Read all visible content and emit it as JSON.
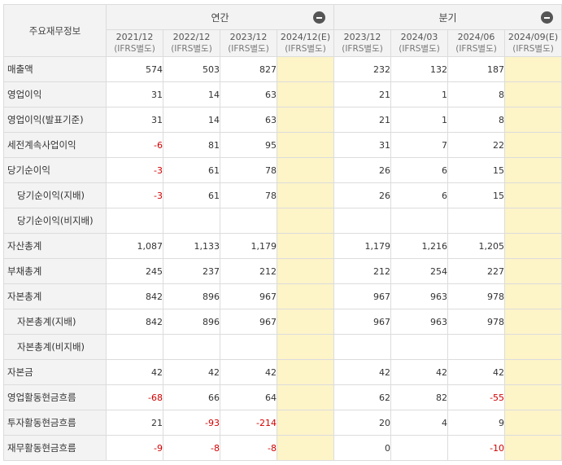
{
  "header": {
    "corner_label": "주요재무정보",
    "groups": [
      {
        "label": "연간",
        "span": 4
      },
      {
        "label": "분기",
        "span": 4
      }
    ],
    "periods": [
      {
        "date": "2021/12",
        "basis": "(IFRS별도)",
        "estimate": false
      },
      {
        "date": "2022/12",
        "basis": "(IFRS별도)",
        "estimate": false
      },
      {
        "date": "2023/12",
        "basis": "(IFRS별도)",
        "estimate": false
      },
      {
        "date": "2024/12(E)",
        "basis": "(IFRS별도)",
        "estimate": true
      },
      {
        "date": "2023/12",
        "basis": "(IFRS별도)",
        "estimate": false
      },
      {
        "date": "2024/03",
        "basis": "(IFRS별도)",
        "estimate": false
      },
      {
        "date": "2024/06",
        "basis": "(IFRS별도)",
        "estimate": false
      },
      {
        "date": "2024/09(E)",
        "basis": "(IFRS별도)",
        "estimate": true
      }
    ]
  },
  "colors": {
    "negative": "#d20000",
    "estimate_bg": "#fdf4c8",
    "header_bg": "#f3f3f3"
  },
  "rows": [
    {
      "label": "매출액",
      "indent": false,
      "values": [
        "574",
        "503",
        "827",
        "",
        "232",
        "132",
        "187",
        ""
      ]
    },
    {
      "label": "영업이익",
      "indent": false,
      "values": [
        "31",
        "14",
        "63",
        "",
        "21",
        "1",
        "8",
        ""
      ]
    },
    {
      "label": "영업이익(발표기준)",
      "indent": false,
      "values": [
        "31",
        "14",
        "63",
        "",
        "21",
        "1",
        "8",
        ""
      ]
    },
    {
      "label": "세전계속사업이익",
      "indent": false,
      "values": [
        "-6",
        "81",
        "95",
        "",
        "31",
        "7",
        "22",
        ""
      ]
    },
    {
      "label": "당기순이익",
      "indent": false,
      "values": [
        "-3",
        "61",
        "78",
        "",
        "26",
        "6",
        "15",
        ""
      ]
    },
    {
      "label": "당기순이익(지배)",
      "indent": true,
      "values": [
        "-3",
        "61",
        "78",
        "",
        "26",
        "6",
        "15",
        ""
      ]
    },
    {
      "label": "당기순이익(비지배)",
      "indent": true,
      "values": [
        "",
        "",
        "",
        "",
        "",
        "",
        "",
        ""
      ]
    },
    {
      "label": "자산총계",
      "indent": false,
      "values": [
        "1,087",
        "1,133",
        "1,179",
        "",
        "1,179",
        "1,216",
        "1,205",
        ""
      ]
    },
    {
      "label": "부채총계",
      "indent": false,
      "values": [
        "245",
        "237",
        "212",
        "",
        "212",
        "254",
        "227",
        ""
      ]
    },
    {
      "label": "자본총계",
      "indent": false,
      "values": [
        "842",
        "896",
        "967",
        "",
        "967",
        "963",
        "978",
        ""
      ]
    },
    {
      "label": "자본총계(지배)",
      "indent": true,
      "values": [
        "842",
        "896",
        "967",
        "",
        "967",
        "963",
        "978",
        ""
      ]
    },
    {
      "label": "자본총계(비지배)",
      "indent": true,
      "values": [
        "",
        "",
        "",
        "",
        "",
        "",
        "",
        ""
      ]
    },
    {
      "label": "자본금",
      "indent": false,
      "values": [
        "42",
        "42",
        "42",
        "",
        "42",
        "42",
        "42",
        ""
      ]
    },
    {
      "label": "영업활동현금흐름",
      "indent": false,
      "values": [
        "-68",
        "66",
        "64",
        "",
        "62",
        "82",
        "-55",
        ""
      ]
    },
    {
      "label": "투자활동현금흐름",
      "indent": false,
      "values": [
        "21",
        "-93",
        "-214",
        "",
        "20",
        "4",
        "9",
        ""
      ]
    },
    {
      "label": "재무활동현금흐름",
      "indent": false,
      "values": [
        "-9",
        "-8",
        "-8",
        "",
        "0",
        "",
        "-10",
        ""
      ]
    }
  ]
}
